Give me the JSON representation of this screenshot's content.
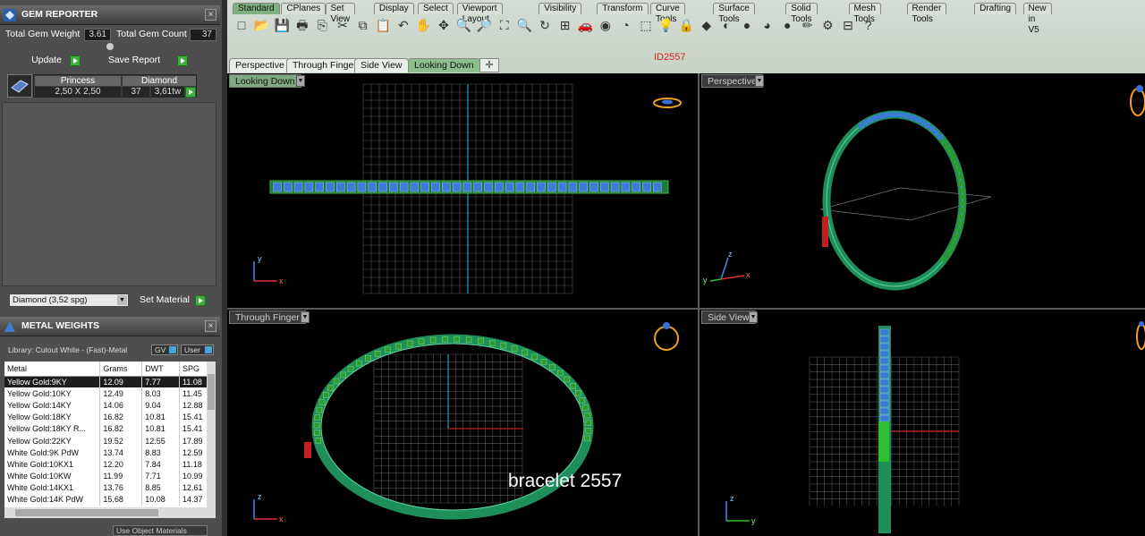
{
  "gem_reporter": {
    "title": "GEM REPORTER",
    "total_weight_label": "Total Gem Weight",
    "total_weight_value": "3.61",
    "total_count_label": "Total Gem Count",
    "total_count_value": "37",
    "update_label": "Update",
    "save_report_label": "Save Report",
    "gem_row": {
      "shape_header": "Princess",
      "type_header": "Diamond",
      "size": "2,50 X 2,50",
      "count": "37",
      "weight": "3,61tw"
    },
    "material_select": "Diamond   (3,52 spg)",
    "set_material_label": "Set Material"
  },
  "metal_weights": {
    "title": "METAL WEIGHTS",
    "library": "Library: Cutout White - (Fast)-Metal",
    "gv_label": "GV",
    "user_label": "User",
    "columns": [
      "Metal",
      "Grams",
      "DWT",
      "SPG"
    ],
    "rows": [
      [
        "Yellow Gold:9KY",
        "12.09",
        "7.77",
        "11.08"
      ],
      [
        "Yellow Gold:10KY",
        "12.49",
        "8.03",
        "11.45"
      ],
      [
        "Yellow Gold:14KY",
        "14.06",
        "9.04",
        "12.88"
      ],
      [
        "Yellow Gold:18KY",
        "16.82",
        "10.81",
        "15.41"
      ],
      [
        "Yellow Gold:18KY R...",
        "16.82",
        "10.81",
        "15.41"
      ],
      [
        "Yellow Gold:22KY",
        "19.52",
        "12.55",
        "17.89"
      ],
      [
        "White Gold:9K PdW",
        "13.74",
        "8.83",
        "12.59"
      ],
      [
        "White Gold:10KX1",
        "12.20",
        "7.84",
        "11.18"
      ],
      [
        "White Gold:10KW",
        "11.99",
        "7.71",
        "10.99"
      ],
      [
        "White Gold:14KX1",
        "13.76",
        "8.85",
        "12.61"
      ],
      [
        "White Gold:14K PdW",
        "15.68",
        "10.08",
        "14.37"
      ]
    ],
    "use_object_materials": "Use Object Materials"
  },
  "toolbar": {
    "tabs": [
      "Standard",
      "CPlanes",
      "Set View",
      "Display",
      "Select",
      "Viewport Layout",
      "Visibility",
      "Transform",
      "Curve Tools",
      "Surface Tools",
      "Solid Tools",
      "Mesh Tools",
      "Render Tools",
      "Drafting",
      "New in V5"
    ],
    "active_tab": "Standard"
  },
  "view_tabs": [
    "Perspective",
    "Through Finger",
    "Side View",
    "Looking Down"
  ],
  "active_view_tab": "Looking Down",
  "model_id": "ID2557",
  "viewports": {
    "top_left": "Looking Down",
    "top_right": "Perspective",
    "bottom_left": "Through Finger",
    "bottom_right": "Side View"
  },
  "overlay_text": "bracelet  2557",
  "colors": {
    "accent": "#3fae3f",
    "stone": "#3a7bd5",
    "metal": "#1e8f5a",
    "prong": "#2f9a2f"
  }
}
